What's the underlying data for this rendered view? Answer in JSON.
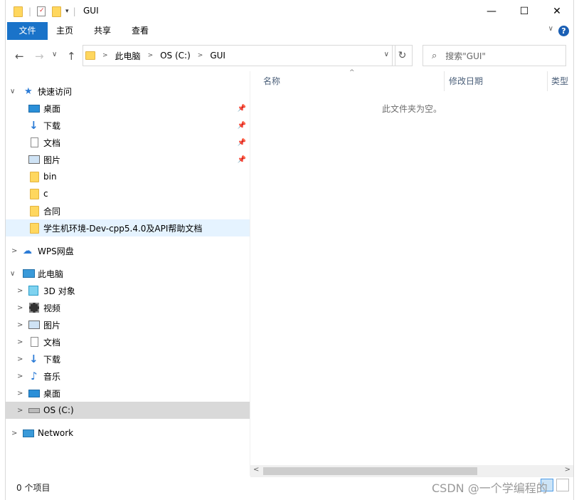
{
  "titlebar": {
    "title": "GUI",
    "minimize": "—",
    "maximize": "☐",
    "close": "✕"
  },
  "ribbon": {
    "tabs": [
      "文件",
      "主页",
      "共享",
      "查看"
    ],
    "help": "?"
  },
  "address": {
    "path": [
      "此电脑",
      "OS (C:)",
      "GUI"
    ],
    "search_placeholder": "搜索\"GUI\""
  },
  "nav": {
    "quick_access": "快速访问",
    "quick_items": [
      "桌面",
      "下载",
      "文档",
      "图片",
      "bin",
      "c",
      "合同",
      "学生机环境-Dev-cpp5.4.0及API帮助文档"
    ],
    "wps": "WPS网盘",
    "this_pc": "此电脑",
    "pc_items": [
      "3D 对象",
      "视频",
      "图片",
      "文档",
      "下载",
      "音乐",
      "桌面",
      "OS (C:)"
    ],
    "network": "Network"
  },
  "content": {
    "columns": [
      "名称",
      "修改日期",
      "类型"
    ],
    "empty_text": "此文件夹为空。"
  },
  "status": {
    "count": "0 个项目"
  },
  "watermark": "CSDN @一个学编程的"
}
